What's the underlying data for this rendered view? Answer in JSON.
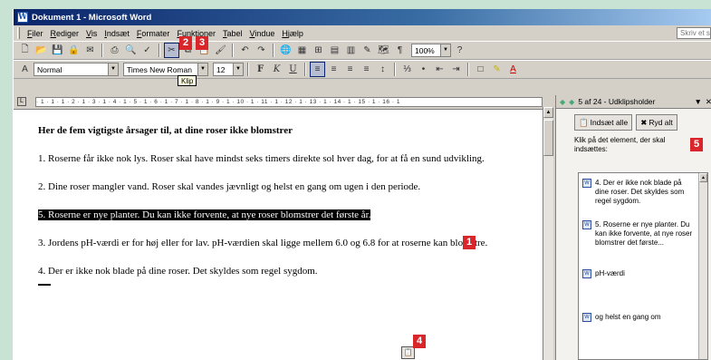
{
  "window": {
    "title": "Dokument 1 - Microsoft Word",
    "app_icon": "W"
  },
  "menubar": {
    "items": [
      "Filer",
      "Rediger",
      "Vis",
      "Indsæt",
      "Formater",
      "Funktioner",
      "Tabel",
      "Vindue",
      "Hjælp"
    ],
    "ask_placeholder": "Skriv et spørgsmål"
  },
  "formatting": {
    "style": "Normal",
    "font": "Times New Roman",
    "size": "12",
    "zoom": "100%"
  },
  "tooltip": "Klip",
  "ruler": "· 1 · 1 · 1 · 2 · 1 · 3 · 1 · 4 · 1 · 5 · 1 · 6 · 1 · 7 · 1 · 8 · 1 · 9 · 1 · 10 · 1 · 11 · 1 · 12 · 1 · 13 · 1 · 14 · 1 · 15 · 1 · 16 · 1",
  "document": {
    "heading": "Her de fem vigtigste årsager til, at dine roser ikke blomstrer",
    "p1": "1. Roserne får ikke nok lys. Roser skal have mindst seks timers direkte sol hver dag, for at få en sund udvikling.",
    "p2": "2. Dine roser mangler vand. Roser skal vandes jævnligt og helst en gang om ugen i den periode.",
    "p_selected": "5. Roserne er nye planter. Du kan ikke forvente, at nye roser blomstrer det første år.",
    "p3": "3. Jordens pH-værdi er for høj eller for lav. pH-værdien skal ligge mellem 6.0 og 6.8 for at roserne kan blomstre.",
    "p4": "4. Der er ikke nok blade på dine roser. Det skyldes som regel sygdom."
  },
  "taskpane": {
    "title": "5 af 24 - Udklipsholder",
    "paste_all": "Indsæt alle",
    "clear_all": "Ryd alt",
    "hint": "Klik på det element, der skal indsættes:",
    "items": [
      "4. Der er ikke nok blade på dine roser. Det skyldes som regel sygdom.",
      "5. Roserne er nye planter. Du kan ikke forvente, at nye roser blomstrer det første...",
      "pH-værdi",
      "og helst en gang om"
    ]
  },
  "badges": {
    "b1": "1",
    "b2": "2",
    "b3": "3",
    "b4": "4",
    "b5": "5"
  },
  "colors": {
    "badge": "#d9262a",
    "background": "#c8e3d3",
    "titlebar": "#0a246a"
  }
}
